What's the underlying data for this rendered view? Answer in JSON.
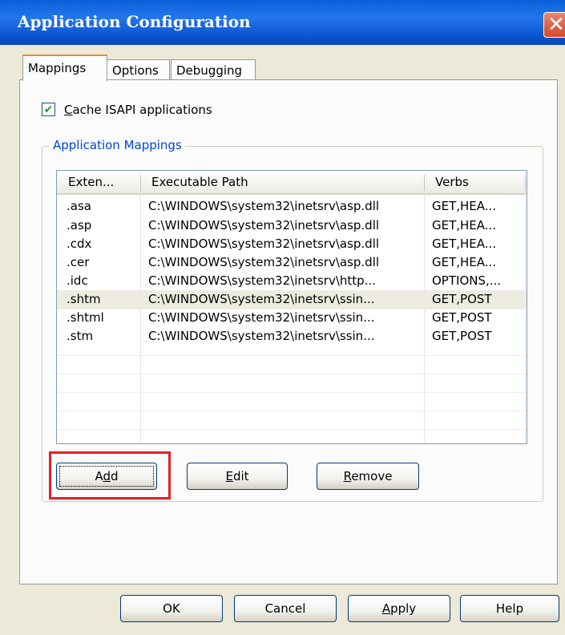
{
  "window": {
    "title": "Application Configuration",
    "close_glyph": "✕"
  },
  "tabs": [
    {
      "label": "Mappings",
      "active": true
    },
    {
      "label": "Options",
      "active": false
    },
    {
      "label": "Debugging",
      "active": false
    }
  ],
  "cache_isapi": {
    "checked": true,
    "label_mnemonic": "C",
    "label_rest": "ache ISAPI applications"
  },
  "group": {
    "legend": "Application Mappings"
  },
  "table": {
    "columns": [
      "Exten...",
      "Executable Path",
      "Verbs"
    ],
    "rows": [
      {
        "ext": ".asa",
        "path": "C:\\WINDOWS\\system32\\inetsrv\\asp.dll",
        "verbs": "GET,HEA..."
      },
      {
        "ext": ".asp",
        "path": "C:\\WINDOWS\\system32\\inetsrv\\asp.dll",
        "verbs": "GET,HEA..."
      },
      {
        "ext": ".cdx",
        "path": "C:\\WINDOWS\\system32\\inetsrv\\asp.dll",
        "verbs": "GET,HEA..."
      },
      {
        "ext": ".cer",
        "path": "C:\\WINDOWS\\system32\\inetsrv\\asp.dll",
        "verbs": "GET,HEA..."
      },
      {
        "ext": ".idc",
        "path": "C:\\WINDOWS\\system32\\inetsrv\\http...",
        "verbs": "OPTIONS,..."
      },
      {
        "ext": ".shtm",
        "path": "C:\\WINDOWS\\system32\\inetsrv\\ssin...",
        "verbs": "GET,POST",
        "selected": true
      },
      {
        "ext": ".shtml",
        "path": "C:\\WINDOWS\\system32\\inetsrv\\ssin...",
        "verbs": "GET,POST"
      },
      {
        "ext": ".stm",
        "path": "C:\\WINDOWS\\system32\\inetsrv\\ssin...",
        "verbs": "GET,POST"
      }
    ]
  },
  "mapping_buttons": {
    "add": {
      "mnemonic_before": "A",
      "mnemonic": "d",
      "after": "d"
    },
    "edit": {
      "mnemonic": "E",
      "after": "dit"
    },
    "remove": {
      "mnemonic": "R",
      "after": "emove"
    }
  },
  "dialog_buttons": {
    "ok": "OK",
    "cancel": "Cancel",
    "apply_mnemonic": "A",
    "apply_rest": "pply",
    "help": "Help"
  },
  "colors": {
    "highlight_box": "#e0202a",
    "title_bar": "#0a5fd9",
    "group_legend": "#0046d5"
  }
}
